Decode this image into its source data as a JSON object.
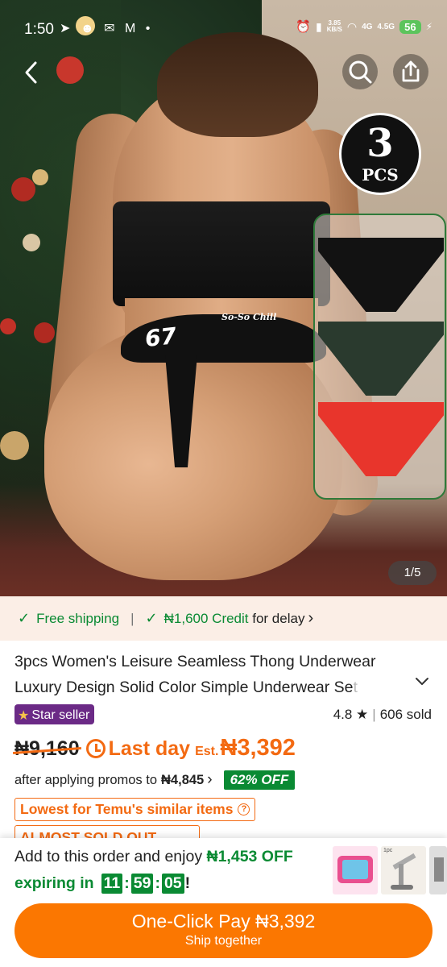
{
  "status_bar": {
    "time": "1:50",
    "notif_glyphs": "➤ ☻ ✉ M •",
    "net_speed_top": "3.85",
    "net_speed_bottom": "KB/S",
    "sig1": "4G",
    "sig2": "4.5G",
    "battery": "56"
  },
  "hero": {
    "pcs_number": "3",
    "pcs_label": "PCS",
    "band_number": "67",
    "band_text": "So-So Chill",
    "image_counter": "1/5",
    "swatch_colors": [
      "#121212",
      "#2a3a2e",
      "#e8352c"
    ]
  },
  "shipping": {
    "free_label": "Free shipping",
    "credit_amount": "₦1,600 Credit",
    "credit_suffix": " for delay",
    "chevron": "›"
  },
  "product": {
    "title_main": "3pcs Women's Leisure Seamless Thong Underwear Luxury Design Solid Color Simple Underwear Se",
    "title_fade": "t",
    "expand_glyph": "⌄",
    "star_seller": "Star seller",
    "rating": "4.8",
    "sold": "606 sold",
    "old_price": "₦9,160",
    "last_day": "Last day",
    "est_label": "Est.",
    "est_price": "₦3,392",
    "promo_text": "after applying promos to",
    "promo_price": "₦4,845",
    "promo_chevron": "›",
    "off_badge": "62% OFF",
    "lowest_label": "Lowest for Temu's similar items",
    "almost_label": "ALMOST SOLD OUT"
  },
  "bottom_bar": {
    "bundle_prefix": "Add to this order and enjoy ",
    "bundle_amount": "₦1,453 OFF",
    "expiring_label": "expiring in",
    "timer_h": "11",
    "timer_m": "59",
    "timer_s": "05",
    "thumb_tag": "1pc",
    "pay_label": "One-Click Pay ₦3,392",
    "pay_sub": "Ship together"
  },
  "colors": {
    "accent_orange": "#fb7701",
    "price_orange": "#f36a12",
    "success_green": "#0a8a33",
    "star_seller_purple": "#6b2a86"
  },
  "icons": [
    "back-icon",
    "search-icon",
    "share-icon",
    "check-icon",
    "star-icon",
    "alarm-icon",
    "question-icon",
    "chevron-down-icon"
  ]
}
